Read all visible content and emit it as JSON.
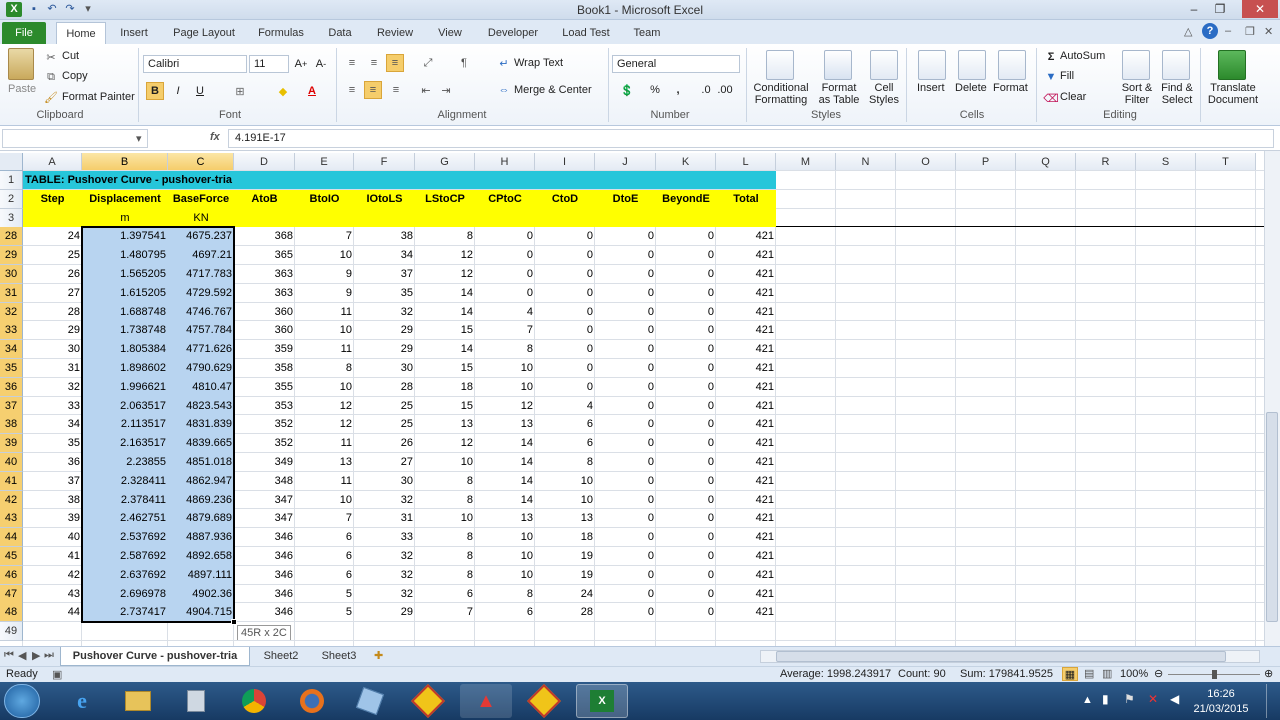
{
  "window": {
    "title": "Book1  -  Microsoft Excel"
  },
  "tabs": [
    "File",
    "Home",
    "Insert",
    "Page Layout",
    "Formulas",
    "Data",
    "Review",
    "View",
    "Developer",
    "Load Test",
    "Team"
  ],
  "ribbon": {
    "paste": "Paste",
    "cut": "Cut",
    "copy": "Copy",
    "format_painter": "Format Painter",
    "clipboard": "Clipboard",
    "font_name": "Calibri",
    "font_size": "11",
    "bold": "B",
    "italic": "I",
    "underline": "U",
    "font": "Font",
    "wrap_text": "Wrap Text",
    "merge_center": "Merge & Center",
    "alignment": "Alignment",
    "number_format": "General",
    "percent": "%",
    "comma": ",",
    "number": "Number",
    "conditional_formatting": [
      "Conditional",
      "Formatting"
    ],
    "format_as_table": [
      "Format",
      "as Table"
    ],
    "cell_styles": [
      "Cell",
      "Styles"
    ],
    "styles": "Styles",
    "insert": "Insert",
    "delete": "Delete",
    "format": "Format",
    "cells": "Cells",
    "autosum": "AutoSum",
    "fill": "Fill",
    "clear": "Clear",
    "sort_filter": [
      "Sort &",
      "Filter"
    ],
    "find_select": [
      "Find &",
      "Select"
    ],
    "editing": "Editing",
    "translate": [
      "Translate",
      "Document"
    ]
  },
  "formula_bar": {
    "fx": "fx",
    "value": "4.191E-17"
  },
  "columns": [
    "A",
    "B",
    "C",
    "D",
    "E",
    "F",
    "G",
    "H",
    "I",
    "J",
    "K",
    "L",
    "M",
    "N",
    "O",
    "P",
    "Q",
    "R",
    "S",
    "T"
  ],
  "table_title": "TABLE:  Pushover Curve - pushover-tria",
  "headers": [
    "Step",
    "Displacement",
    "BaseForce",
    "AtoB",
    "BtoIO",
    "IOtoLS",
    "LStoCP",
    "CPtoC",
    "CtoD",
    "DtoE",
    "BeyondE",
    "Total"
  ],
  "units": [
    "",
    "m",
    "KN",
    "",
    "",
    "",
    "",
    "",
    "",
    "",
    "",
    ""
  ],
  "rows": [
    {
      "r": "28",
      "v": [
        "24",
        "1.397541",
        "4675.237",
        "368",
        "7",
        "38",
        "8",
        "0",
        "0",
        "0",
        "0",
        "421"
      ]
    },
    {
      "r": "29",
      "v": [
        "25",
        "1.480795",
        "4697.21",
        "365",
        "10",
        "34",
        "12",
        "0",
        "0",
        "0",
        "0",
        "421"
      ]
    },
    {
      "r": "30",
      "v": [
        "26",
        "1.565205",
        "4717.783",
        "363",
        "9",
        "37",
        "12",
        "0",
        "0",
        "0",
        "0",
        "421"
      ]
    },
    {
      "r": "31",
      "v": [
        "27",
        "1.615205",
        "4729.592",
        "363",
        "9",
        "35",
        "14",
        "0",
        "0",
        "0",
        "0",
        "421"
      ]
    },
    {
      "r": "32",
      "v": [
        "28",
        "1.688748",
        "4746.767",
        "360",
        "11",
        "32",
        "14",
        "4",
        "0",
        "0",
        "0",
        "421"
      ]
    },
    {
      "r": "33",
      "v": [
        "29",
        "1.738748",
        "4757.784",
        "360",
        "10",
        "29",
        "15",
        "7",
        "0",
        "0",
        "0",
        "421"
      ]
    },
    {
      "r": "34",
      "v": [
        "30",
        "1.805384",
        "4771.626",
        "359",
        "11",
        "29",
        "14",
        "8",
        "0",
        "0",
        "0",
        "421"
      ]
    },
    {
      "r": "35",
      "v": [
        "31",
        "1.898602",
        "4790.629",
        "358",
        "8",
        "30",
        "15",
        "10",
        "0",
        "0",
        "0",
        "421"
      ]
    },
    {
      "r": "36",
      "v": [
        "32",
        "1.996621",
        "4810.47",
        "355",
        "10",
        "28",
        "18",
        "10",
        "0",
        "0",
        "0",
        "421"
      ]
    },
    {
      "r": "37",
      "v": [
        "33",
        "2.063517",
        "4823.543",
        "353",
        "12",
        "25",
        "15",
        "12",
        "4",
        "0",
        "0",
        "421"
      ]
    },
    {
      "r": "38",
      "v": [
        "34",
        "2.113517",
        "4831.839",
        "352",
        "12",
        "25",
        "13",
        "13",
        "6",
        "0",
        "0",
        "421"
      ]
    },
    {
      "r": "39",
      "v": [
        "35",
        "2.163517",
        "4839.665",
        "352",
        "11",
        "26",
        "12",
        "14",
        "6",
        "0",
        "0",
        "421"
      ]
    },
    {
      "r": "40",
      "v": [
        "36",
        "2.23855",
        "4851.018",
        "349",
        "13",
        "27",
        "10",
        "14",
        "8",
        "0",
        "0",
        "421"
      ]
    },
    {
      "r": "41",
      "v": [
        "37",
        "2.328411",
        "4862.947",
        "348",
        "11",
        "30",
        "8",
        "14",
        "10",
        "0",
        "0",
        "421"
      ]
    },
    {
      "r": "42",
      "v": [
        "38",
        "2.378411",
        "4869.236",
        "347",
        "10",
        "32",
        "8",
        "14",
        "10",
        "0",
        "0",
        "421"
      ]
    },
    {
      "r": "43",
      "v": [
        "39",
        "2.462751",
        "4879.689",
        "347",
        "7",
        "31",
        "10",
        "13",
        "13",
        "0",
        "0",
        "421"
      ]
    },
    {
      "r": "44",
      "v": [
        "40",
        "2.537692",
        "4887.936",
        "346",
        "6",
        "33",
        "8",
        "10",
        "18",
        "0",
        "0",
        "421"
      ]
    },
    {
      "r": "45",
      "v": [
        "41",
        "2.587692",
        "4892.658",
        "346",
        "6",
        "32",
        "8",
        "10",
        "19",
        "0",
        "0",
        "421"
      ]
    },
    {
      "r": "46",
      "v": [
        "42",
        "2.637692",
        "4897.111",
        "346",
        "6",
        "32",
        "8",
        "10",
        "19",
        "0",
        "0",
        "421"
      ]
    },
    {
      "r": "47",
      "v": [
        "43",
        "2.696978",
        "4902.36",
        "346",
        "5",
        "32",
        "6",
        "8",
        "24",
        "0",
        "0",
        "421"
      ]
    },
    {
      "r": "48",
      "v": [
        "44",
        "2.737417",
        "4904.715",
        "346",
        "5",
        "29",
        "7",
        "6",
        "28",
        "0",
        "0",
        "421"
      ]
    }
  ],
  "empty_row": "49",
  "selection_tip": "45R x 2C",
  "sheets": [
    "Pushover Curve - pushover-tria",
    "Sheet2",
    "Sheet3"
  ],
  "status": {
    "ready": "Ready",
    "average": "Average: 1998.243917",
    "count": "Count: 90",
    "sum": "Sum: 179841.9525",
    "zoom": "100%"
  },
  "taskbar": {
    "time": "16:26",
    "date": "21/03/2015"
  },
  "colors": {
    "title_fill": "#26c6da",
    "header_fill": "#ffff00",
    "selection": "#b8d4f0",
    "file_tab": "#2c8a2c"
  }
}
